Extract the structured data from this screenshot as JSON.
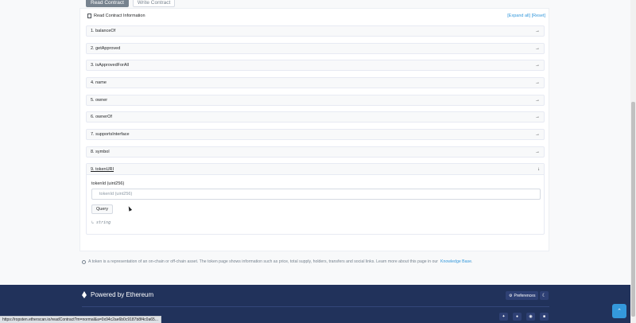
{
  "tabs": {
    "read": "Read Contract",
    "write": "Write Contract"
  },
  "header": {
    "title": "Read Contract Information",
    "expand_all": "[Expand all]",
    "reset": "[Reset]"
  },
  "methods": [
    "1. balanceOf",
    "2. getApproved",
    "3. isApprovedForAll",
    "4. name",
    "5. owner",
    "6. ownerOf",
    "7. supportsInterface",
    "8. symbol"
  ],
  "open_method": {
    "label": "9. tokenURI",
    "param_label": "tokenId (uint256)",
    "param_placeholder": "tokenId (uint256)",
    "query_label": "Query",
    "output": "↳ string"
  },
  "info": {
    "text": "A token is a representation of an on-chain or off-chain asset. The token page shows information such as price, total supply, holders, transfers and social links. Learn more about this page in our",
    "link": "Knowledge Base",
    "end": "."
  },
  "footer": {
    "powered": "Powered by Ethereum",
    "preferences": "Preferences"
  },
  "status_url": "https://ropsten.etherscan.io/readContract?m=normal&a=0x94c2ae6b0c9187b8f4c0a65..."
}
